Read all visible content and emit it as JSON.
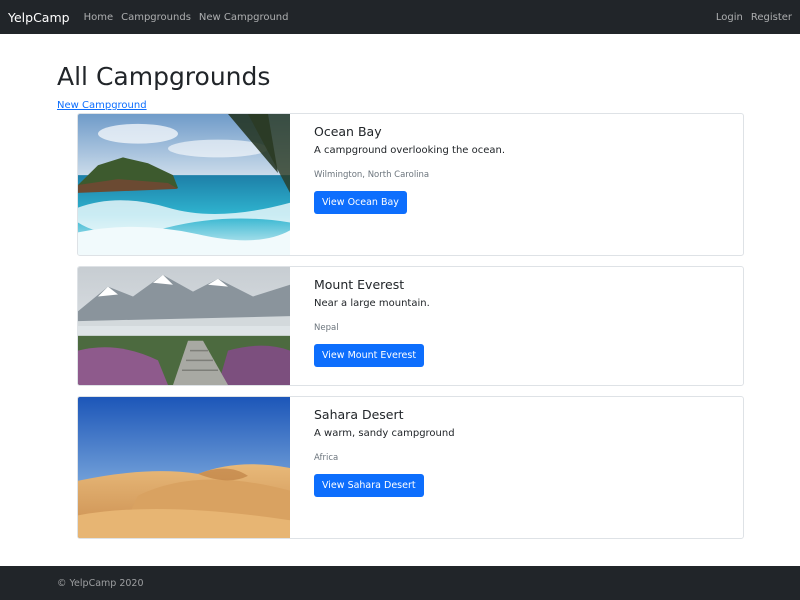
{
  "navbar": {
    "brand": "YelpCamp",
    "links": [
      "Home",
      "Campgrounds",
      "New Campground"
    ],
    "right_links": [
      "Login",
      "Register"
    ]
  },
  "main": {
    "title": "All Campgrounds",
    "new_link": "New Campground",
    "campgrounds": [
      {
        "name": "Ocean Bay",
        "description": "A campground overlooking the ocean.",
        "location": "Wilmington, North Carolina",
        "button": "View Ocean Bay",
        "image": "ocean-beach-photo"
      },
      {
        "name": "Mount Everest",
        "description": "Near a large mountain.",
        "location": "Nepal",
        "button": "View Mount Everest",
        "image": "mountain-path-photo"
      },
      {
        "name": "Sahara Desert",
        "description": "A warm, sandy campground",
        "location": "Africa",
        "button": "View Sahara Desert",
        "image": "desert-dunes-photo"
      }
    ]
  },
  "footer": {
    "text": "© YelpCamp 2020"
  },
  "colors": {
    "navbar_bg": "#212529",
    "primary": "#0d6efd",
    "muted": "#6c757d",
    "border": "#dee2e6"
  }
}
